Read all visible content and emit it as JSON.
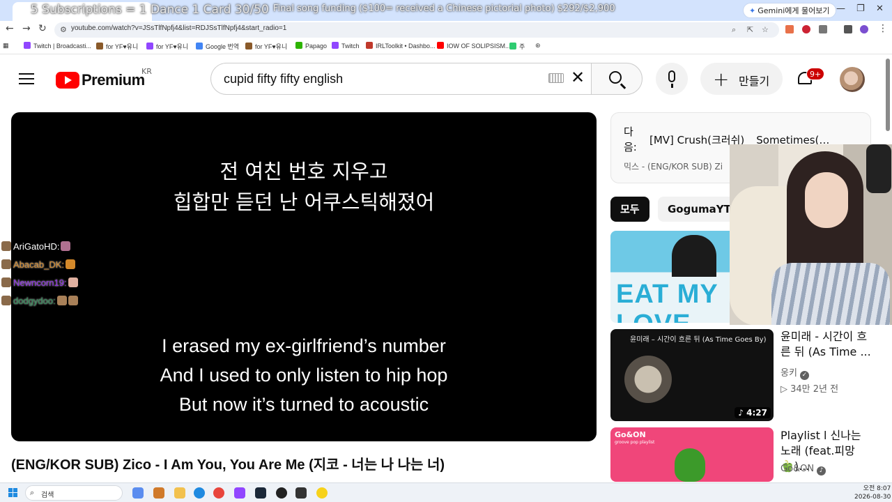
{
  "overlay": {
    "top_text": "5 Subscriptions = 1 Dance 1 Card 30/50",
    "funding": "Final song funding ($100= received a Chinese pictorial photo) $292/$2,900"
  },
  "browser": {
    "gemini_button": "Gemini에게 물어보기",
    "url": "youtube.com/watch?v=JSsTlfNpfj4&list=RDJSsTlfNpfj4&start_radio=1",
    "bookmarks": [
      {
        "label": "Twitch | Broadcasti...",
        "color": "#9146ff"
      },
      {
        "label": "for YF♥유니",
        "color": "#8a5a2a"
      },
      {
        "label": "for YF♥유니",
        "color": "#9146ff"
      },
      {
        "label": "Google 번역",
        "color": "#4285f4"
      },
      {
        "label": "for YF♥유니",
        "color": "#8a5a2a"
      },
      {
        "label": "Papago",
        "color": "#2db400"
      },
      {
        "label": "Twitch",
        "color": "#9146ff"
      },
      {
        "label": "IRLToolkit • Dashbo...",
        "color": "#c0392b"
      },
      {
        "label": "IOW OF SOLIPSISM...",
        "color": "#ff0000"
      },
      {
        "label": "주",
        "color": "#2ecc71"
      }
    ]
  },
  "youtube": {
    "logo_text": "Premium",
    "region": "KR",
    "search_value": "cupid fifty fifty english",
    "create_label": "만들기",
    "notification_count": "9+"
  },
  "player": {
    "lyrics_ko": [
      "전 여친 번호 지우고",
      "힙합만 듣던 난 어쿠스틱해졌어"
    ],
    "lyrics_en": [
      "I erased my ex-girlfriend’s number",
      "And I used to only listen to hip hop",
      "But now it’s turned to acoustic"
    ]
  },
  "chat": [
    {
      "user": "AriGatoHD:",
      "color": "#ffffff",
      "emote": "#b07090"
    },
    {
      "user": "Abacab_DK:",
      "color": "#d4892a",
      "emote": "#d4892a"
    },
    {
      "user": "Newncorn19:",
      "color": "#8a2be2",
      "emote": "#e0b0a0"
    },
    {
      "user": "dodgydoo:",
      "color": "#2e8b57",
      "emote": "#a88058"
    }
  ],
  "video_title": "(ENG/KOR SUB) Zico - I Am You, You Are Me (지코 - 너는 나 나는 너)",
  "sidebar": {
    "next_label": "다음:",
    "next_title": "[MV] Crush(크러쉬) _ Sometimes(…",
    "next_sub": "믹스 - (ENG/KOR SUB) Zi",
    "chips": [
      "모두",
      "GogumaYT 기"
    ],
    "thumb1_text": "EAT MY LOVE",
    "thumb2_title": "윤미래 – 시간이 흐른 뒤 (As Time Goes By)",
    "thumb2_duration": "4:27",
    "thumb3_brand": "Go&ON",
    "thumb3_sub": "groove pop playlist",
    "related": [
      {
        "title": "윤미래 - 시간이 흐른 뒤 (As Time ...",
        "channel": "웅키",
        "meta": "▷ 34만  2년 전"
      },
      {
        "title": "Playlist l 신나는 노래 (feat.피망 🫑)...",
        "channel": "Go&ON",
        "meta": ""
      }
    ]
  },
  "taskbar": {
    "search_label": "검색",
    "time": "오전 8:07",
    "date": "2026-08-30"
  }
}
